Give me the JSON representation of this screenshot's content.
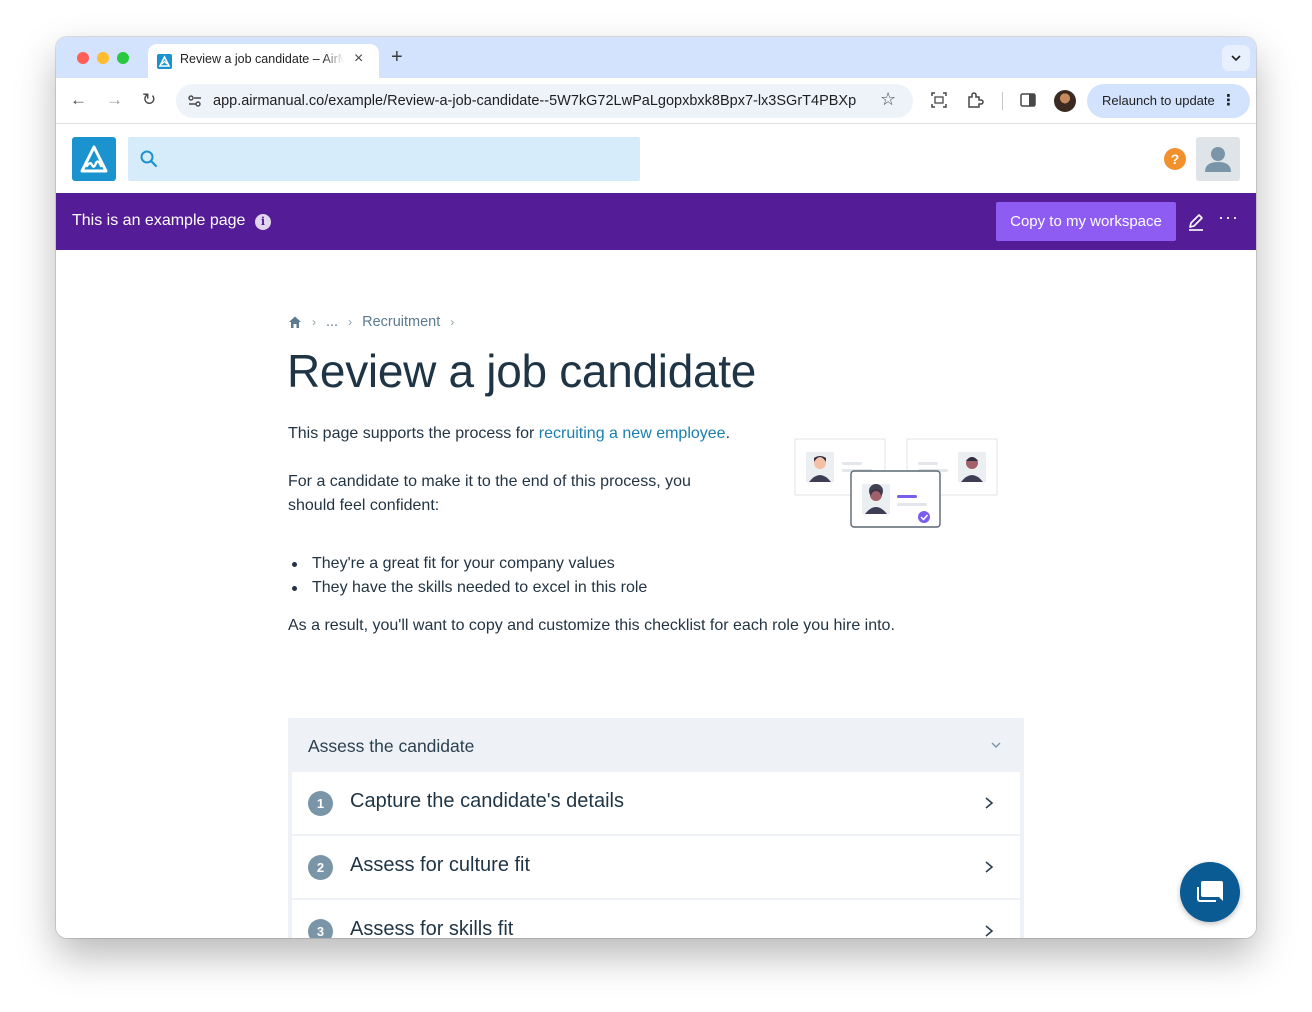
{
  "browser": {
    "tab_title": "Review a job candidate – AirManual",
    "tab_close": "×",
    "new_tab": "+",
    "tab_menu": "⌄",
    "url": "app.airmanual.co/example/Review-a-job-candidate--5W7kG72LwPaLgopxbxk8Bpx7-lx3SGrT4PBXp",
    "relaunch_label": "Relaunch to update",
    "relaunch_dots": "⋮",
    "back": "←",
    "forward": "→",
    "reload": "↻",
    "star": "☆"
  },
  "header": {
    "search_placeholder": "",
    "help": "?"
  },
  "banner": {
    "text": "This is an example page",
    "info": "i",
    "copy_button": "Copy to my workspace",
    "more": "···"
  },
  "breadcrumb": {
    "ellipsis": "...",
    "parent": "Recruitment",
    "sep": "›"
  },
  "page": {
    "title": "Review a job candidate",
    "intro_before": "This page supports the process for ",
    "intro_link": "recruiting a new employee",
    "intro_after": ".",
    "para2": "For a candidate to make it to the end of this process, you should feel confident:",
    "bullets": [
      "They're a great fit for your company values",
      "They have the skills needed to excel in this role"
    ],
    "para3": "As a result, you'll want to copy and customize this checklist for each role you hire into."
  },
  "section": {
    "title": "Assess the candidate",
    "steps": [
      {
        "number": "1",
        "label": "Capture the candidate's details"
      },
      {
        "number": "2",
        "label": "Assess for culture fit"
      },
      {
        "number": "3",
        "label": "Assess for skills fit"
      }
    ]
  },
  "colors": {
    "banner": "#551c97",
    "copy_button": "#8e5cf2",
    "brand": "#1a93cf",
    "link": "#1a7fb0",
    "help": "#f0912c",
    "chat": "#0a5a93"
  }
}
